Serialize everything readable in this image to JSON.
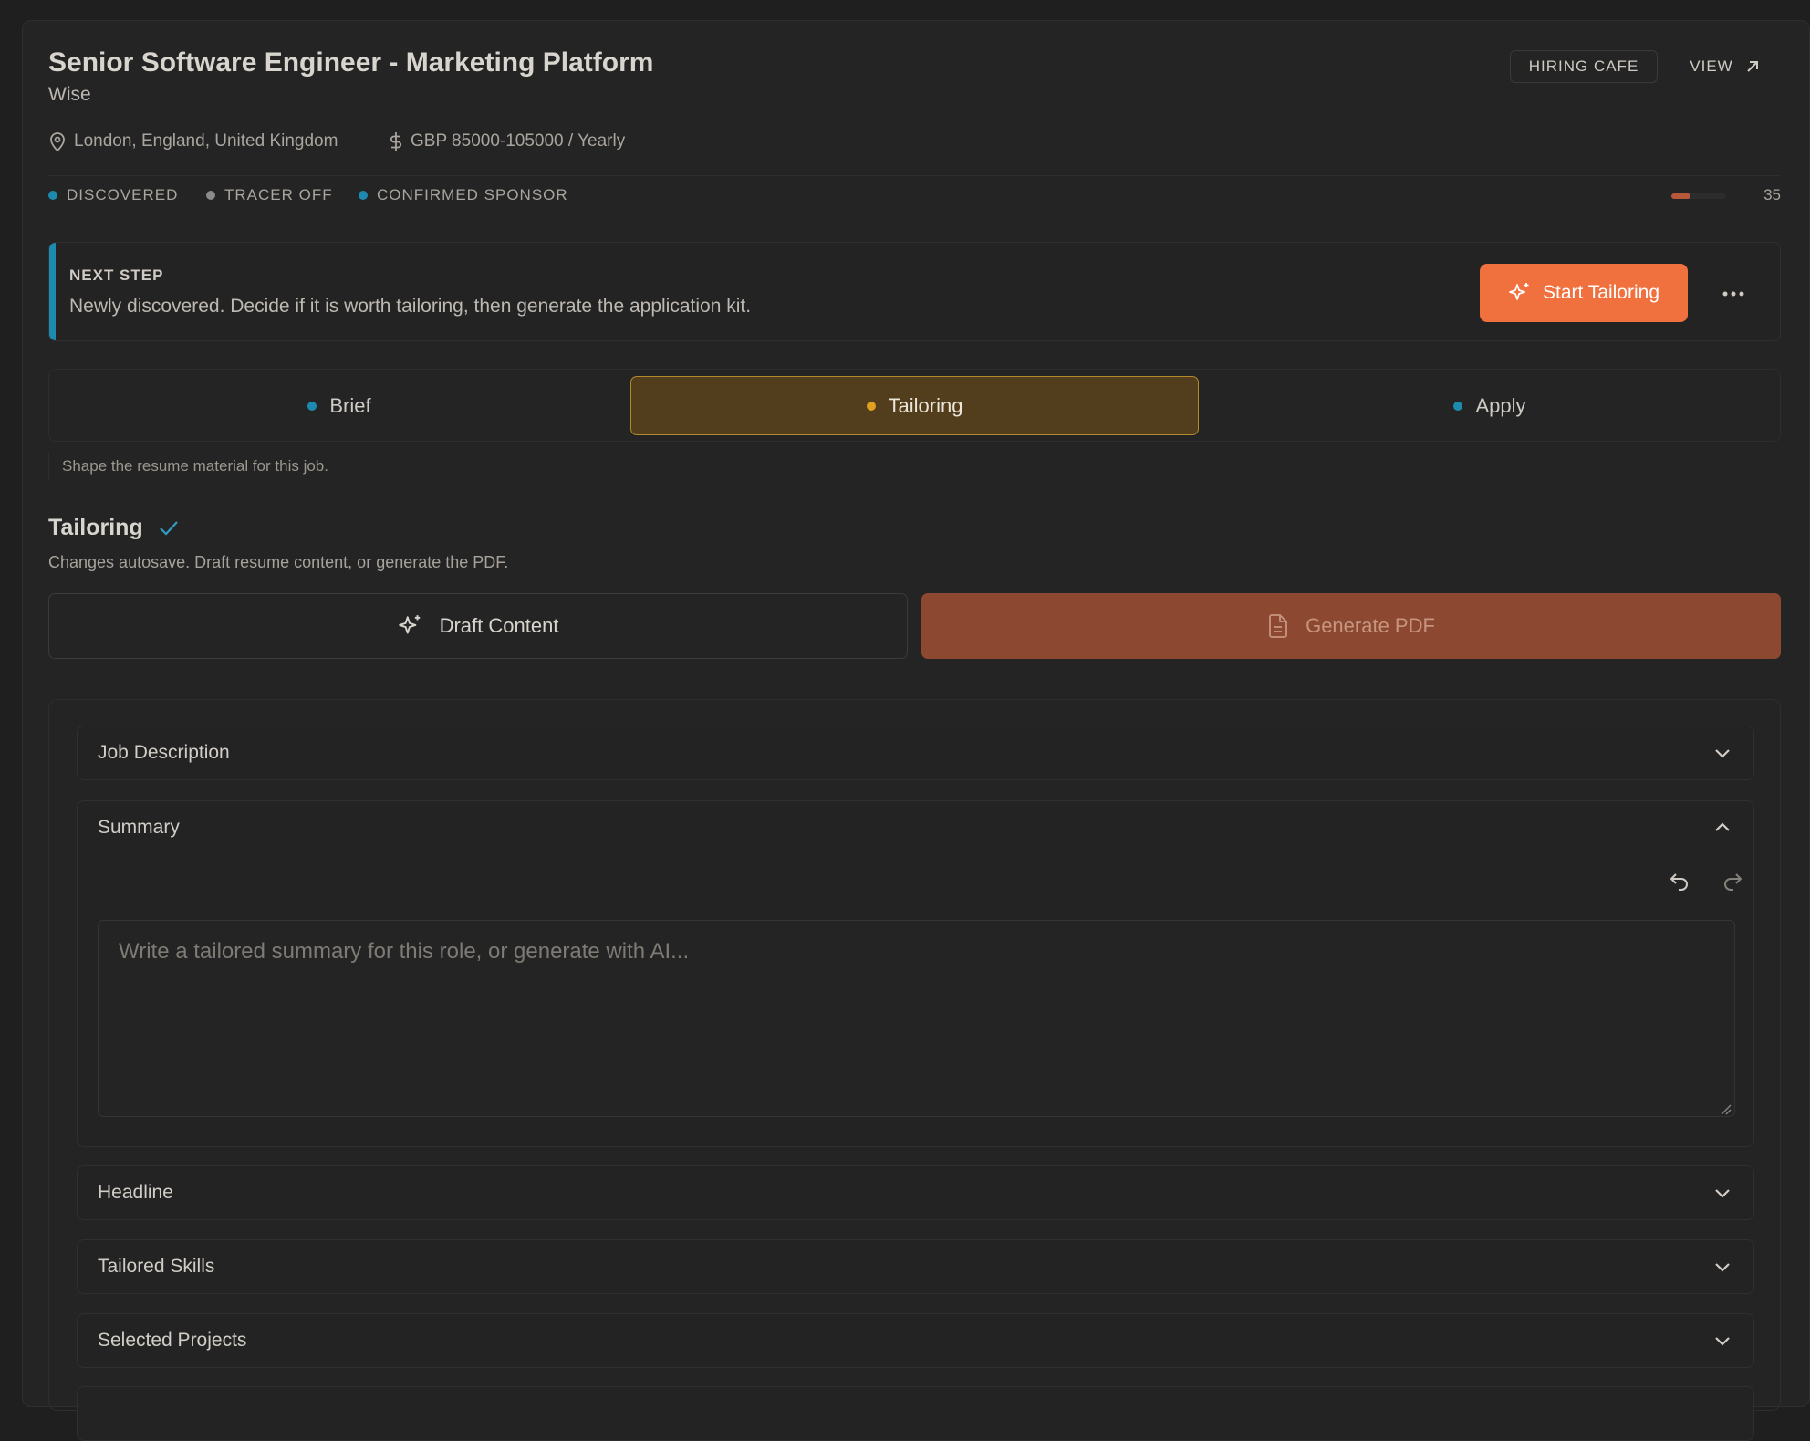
{
  "job": {
    "title": "Senior Software Engineer - Marketing Platform",
    "company": "Wise",
    "location": "London, England, United Kingdom",
    "salary": "GBP 85000-105000 / Yearly"
  },
  "header_actions": {
    "source_label": "HIRING CAFE",
    "view_label": "VIEW"
  },
  "status": {
    "items": [
      {
        "label": "DISCOVERED",
        "color": "#1d8bb0"
      },
      {
        "label": "TRACER OFF",
        "color": "#8a8a8a"
      },
      {
        "label": "CONFIRMED SPONSOR",
        "color": "#1d8bb0"
      }
    ],
    "score": "35",
    "score_fraction": 0.35
  },
  "next_step": {
    "label": "NEXT STEP",
    "text": "Newly discovered. Decide if it is worth tailoring, then generate the application kit.",
    "primary_button": "Start Tailoring"
  },
  "tabs": [
    {
      "label": "Brief",
      "dot": "#1d8bb0"
    },
    {
      "label": "Tailoring",
      "dot": "#e0a020"
    },
    {
      "label": "Apply",
      "dot": "#1d8bb0"
    }
  ],
  "tab_hint": "Shape the resume material for this job.",
  "section": {
    "title": "Tailoring",
    "subtitle": "Changes autosave. Draft resume content, or generate the PDF.",
    "draft_button": "Draft Content",
    "pdf_button": "Generate PDF"
  },
  "accordions": {
    "job_description": "Job Description",
    "summary": "Summary",
    "summary_placeholder": "Write a tailored summary for this role, or generate with AI...",
    "headline": "Headline",
    "tailored_skills": "Tailored Skills",
    "selected_projects": "Selected Projects"
  }
}
